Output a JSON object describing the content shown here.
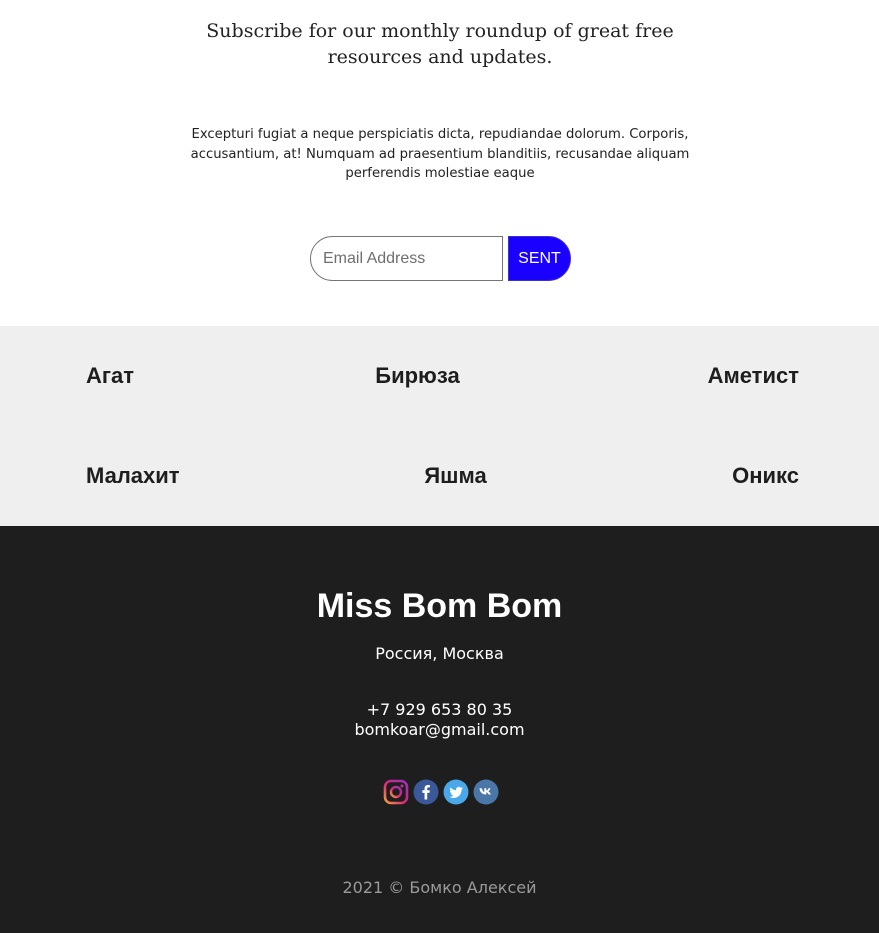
{
  "subscribe": {
    "title": "Subscribe for our monthly roundup of great free resources and updates.",
    "text": "Excepturi fugiat a neque perspiciatis dicta, repudiandae dolorum. Corporis, accusantium, at! Numquam ad praesentium blanditiis, recusandae aliquam perferendis molestiae eaque",
    "email_placeholder": "Email Address",
    "email_value": "",
    "button_label": "SENT",
    "button_color": "#1a00ff"
  },
  "categories": {
    "background": "#efefef",
    "items": [
      "Агат",
      "Бирюза",
      "Аметист",
      "Малахит",
      "Яшма",
      "Оникс"
    ]
  },
  "footer": {
    "background": "#1e1e1e",
    "brand": "Miss Bom Bom",
    "city": "Россия, Москва",
    "phone": "+7 929 653 80 35",
    "email": "bomkoar@gmail.com",
    "socials": [
      "instagram-icon",
      "facebook-icon",
      "twitter-icon",
      "vk-icon"
    ],
    "copyright": "2021 © Бомко Алексей"
  }
}
